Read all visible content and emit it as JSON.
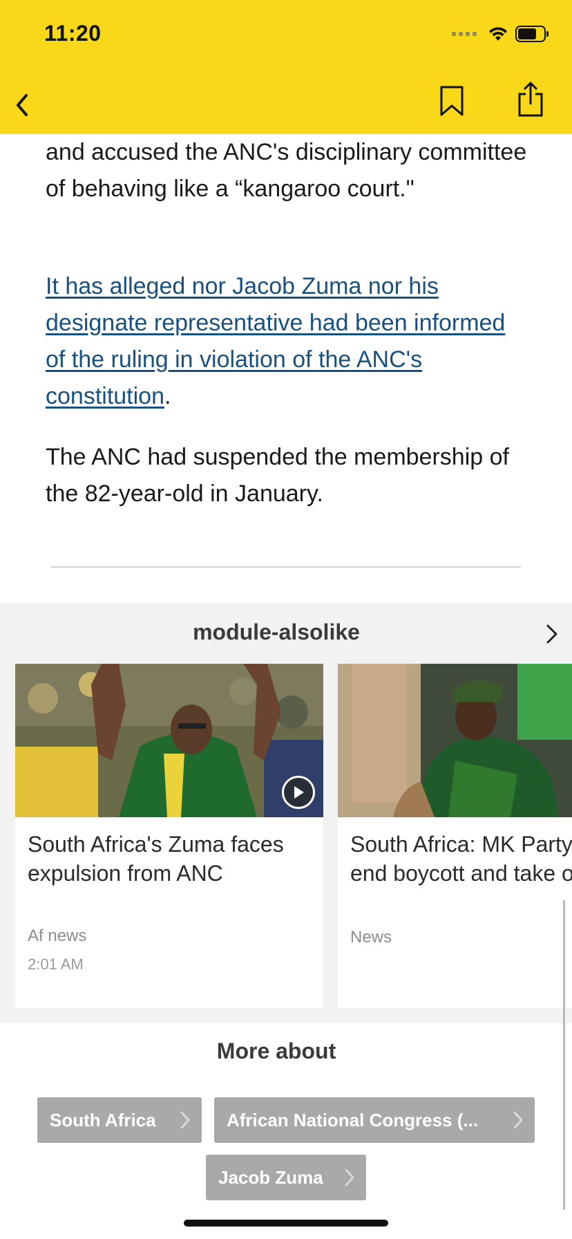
{
  "status_bar": {
    "time": "11:20"
  },
  "nav": {
    "back_icon": "chevron-left-icon",
    "bookmark_icon": "bookmark-icon",
    "share_icon": "share-icon"
  },
  "article": {
    "p1": "and accused the ANC's disciplinary committee of behaving like a “kangaroo court.\"",
    "p2_link": "It has alleged nor Jacob Zuma nor his designate representative had been informed of the ruling in violation of the ANC's constitution",
    "p2_tail": ".",
    "p3": "The ANC had suspended the membership of the 82-year-old in January."
  },
  "also_like": {
    "title": "module-alsolike",
    "cards": [
      {
        "title": "South Africa's Zuma faces expulsion from ANC",
        "source": "Af news",
        "time": "2:01 AM",
        "has_video": true
      },
      {
        "title": "South Africa: MK Party MPs end boycott and take oath",
        "source": "News",
        "time": ""
      }
    ]
  },
  "more_about": {
    "title": "More about",
    "tags": [
      "South Africa",
      "African National Congress (...",
      "Jacob Zuma"
    ]
  },
  "colors": {
    "header_yellow": "#f8d818",
    "link_blue": "#18507f",
    "tag_grey": "#a9a9a9"
  }
}
